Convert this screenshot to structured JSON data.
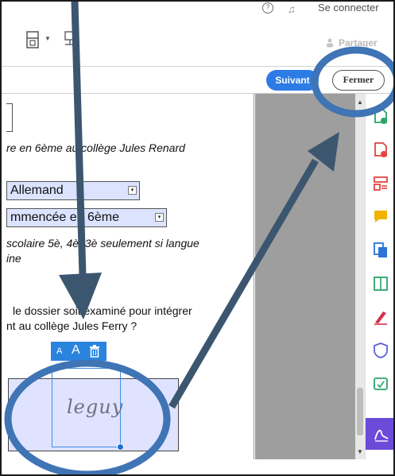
{
  "topbar": {
    "help_icon": "help-icon",
    "bell_icon": "bell-icon",
    "login_label": "Se connecter"
  },
  "toolbar": {
    "compress_icon": "file-compress-icon",
    "stamp_icon": "stamp-icon",
    "share_label": "Partager"
  },
  "subbar": {
    "next_label": "Suivant",
    "close_label": "Fermer"
  },
  "document": {
    "line1": "re en 6ème au collège Jules Renard",
    "select1_value": "Allemand",
    "select2_value": "mmencée en 6ème",
    "line2": "scolaire 5è, 4è, 3è seulement si langue",
    "line3": "ine",
    "line4": "le dossier soit examiné pour intégrer",
    "line5": "nt au collège Jules Ferry ?",
    "signature_text": "leguy",
    "sig_toolbar": {
      "small_a": "A",
      "large_a": "A"
    }
  },
  "rail": {
    "items": [
      "export-pdf-icon",
      "create-pdf-icon",
      "organize-pages-icon",
      "comment-icon",
      "combine-files-icon",
      "compress-icon",
      "fill-sign-icon",
      "protect-icon",
      "send-for-signature-icon",
      "signature-icon"
    ]
  },
  "colors": {
    "accent_blue": "#2d7be5",
    "annotation_ring": "#3f74b5",
    "arrow": "#3c5670",
    "rail_active": "#6b4bd8",
    "field_fill": "#dbe3ff"
  }
}
